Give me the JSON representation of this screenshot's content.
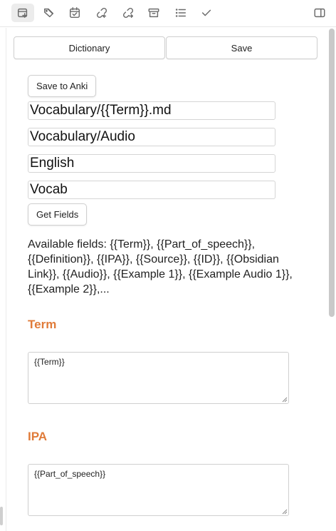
{
  "toolbar": {
    "icons": [
      "new-card-icon",
      "tags-icon",
      "calendar-check-icon",
      "unlink-icon",
      "link-arrow-icon",
      "archive-icon",
      "list-icon",
      "check-icon",
      "sidebar-toggle-icon"
    ]
  },
  "top_buttons": {
    "dictionary_label": "Dictionary",
    "save_label": "Save"
  },
  "actions": {
    "save_to_anki_label": "Save to Anki",
    "get_fields_label": "Get Fields"
  },
  "inputs": {
    "file_path": "Vocabulary/{{Term}}.md",
    "audio_path": "Vocabulary/Audio",
    "deck": "English",
    "note_type": "Vocab"
  },
  "available_fields_text": "Available fields: {{Term}}, {{Part_of_speech}}, {{Definition}}, {{IPA}}, {{Source}}, {{ID}}, {{Obsidian Link}}, {{Audio}}, {{Example 1}}, {{Example Audio 1}}, {{Example 2}},...",
  "sections": [
    {
      "title": "Term",
      "value": "{{Term}}"
    },
    {
      "title": "IPA",
      "value": "{{Part_of_speech}}"
    }
  ],
  "colors": {
    "section_accent": "#e07b39",
    "active_tab_bg": "#ececec",
    "scrollbar": "#c9c9c9"
  }
}
